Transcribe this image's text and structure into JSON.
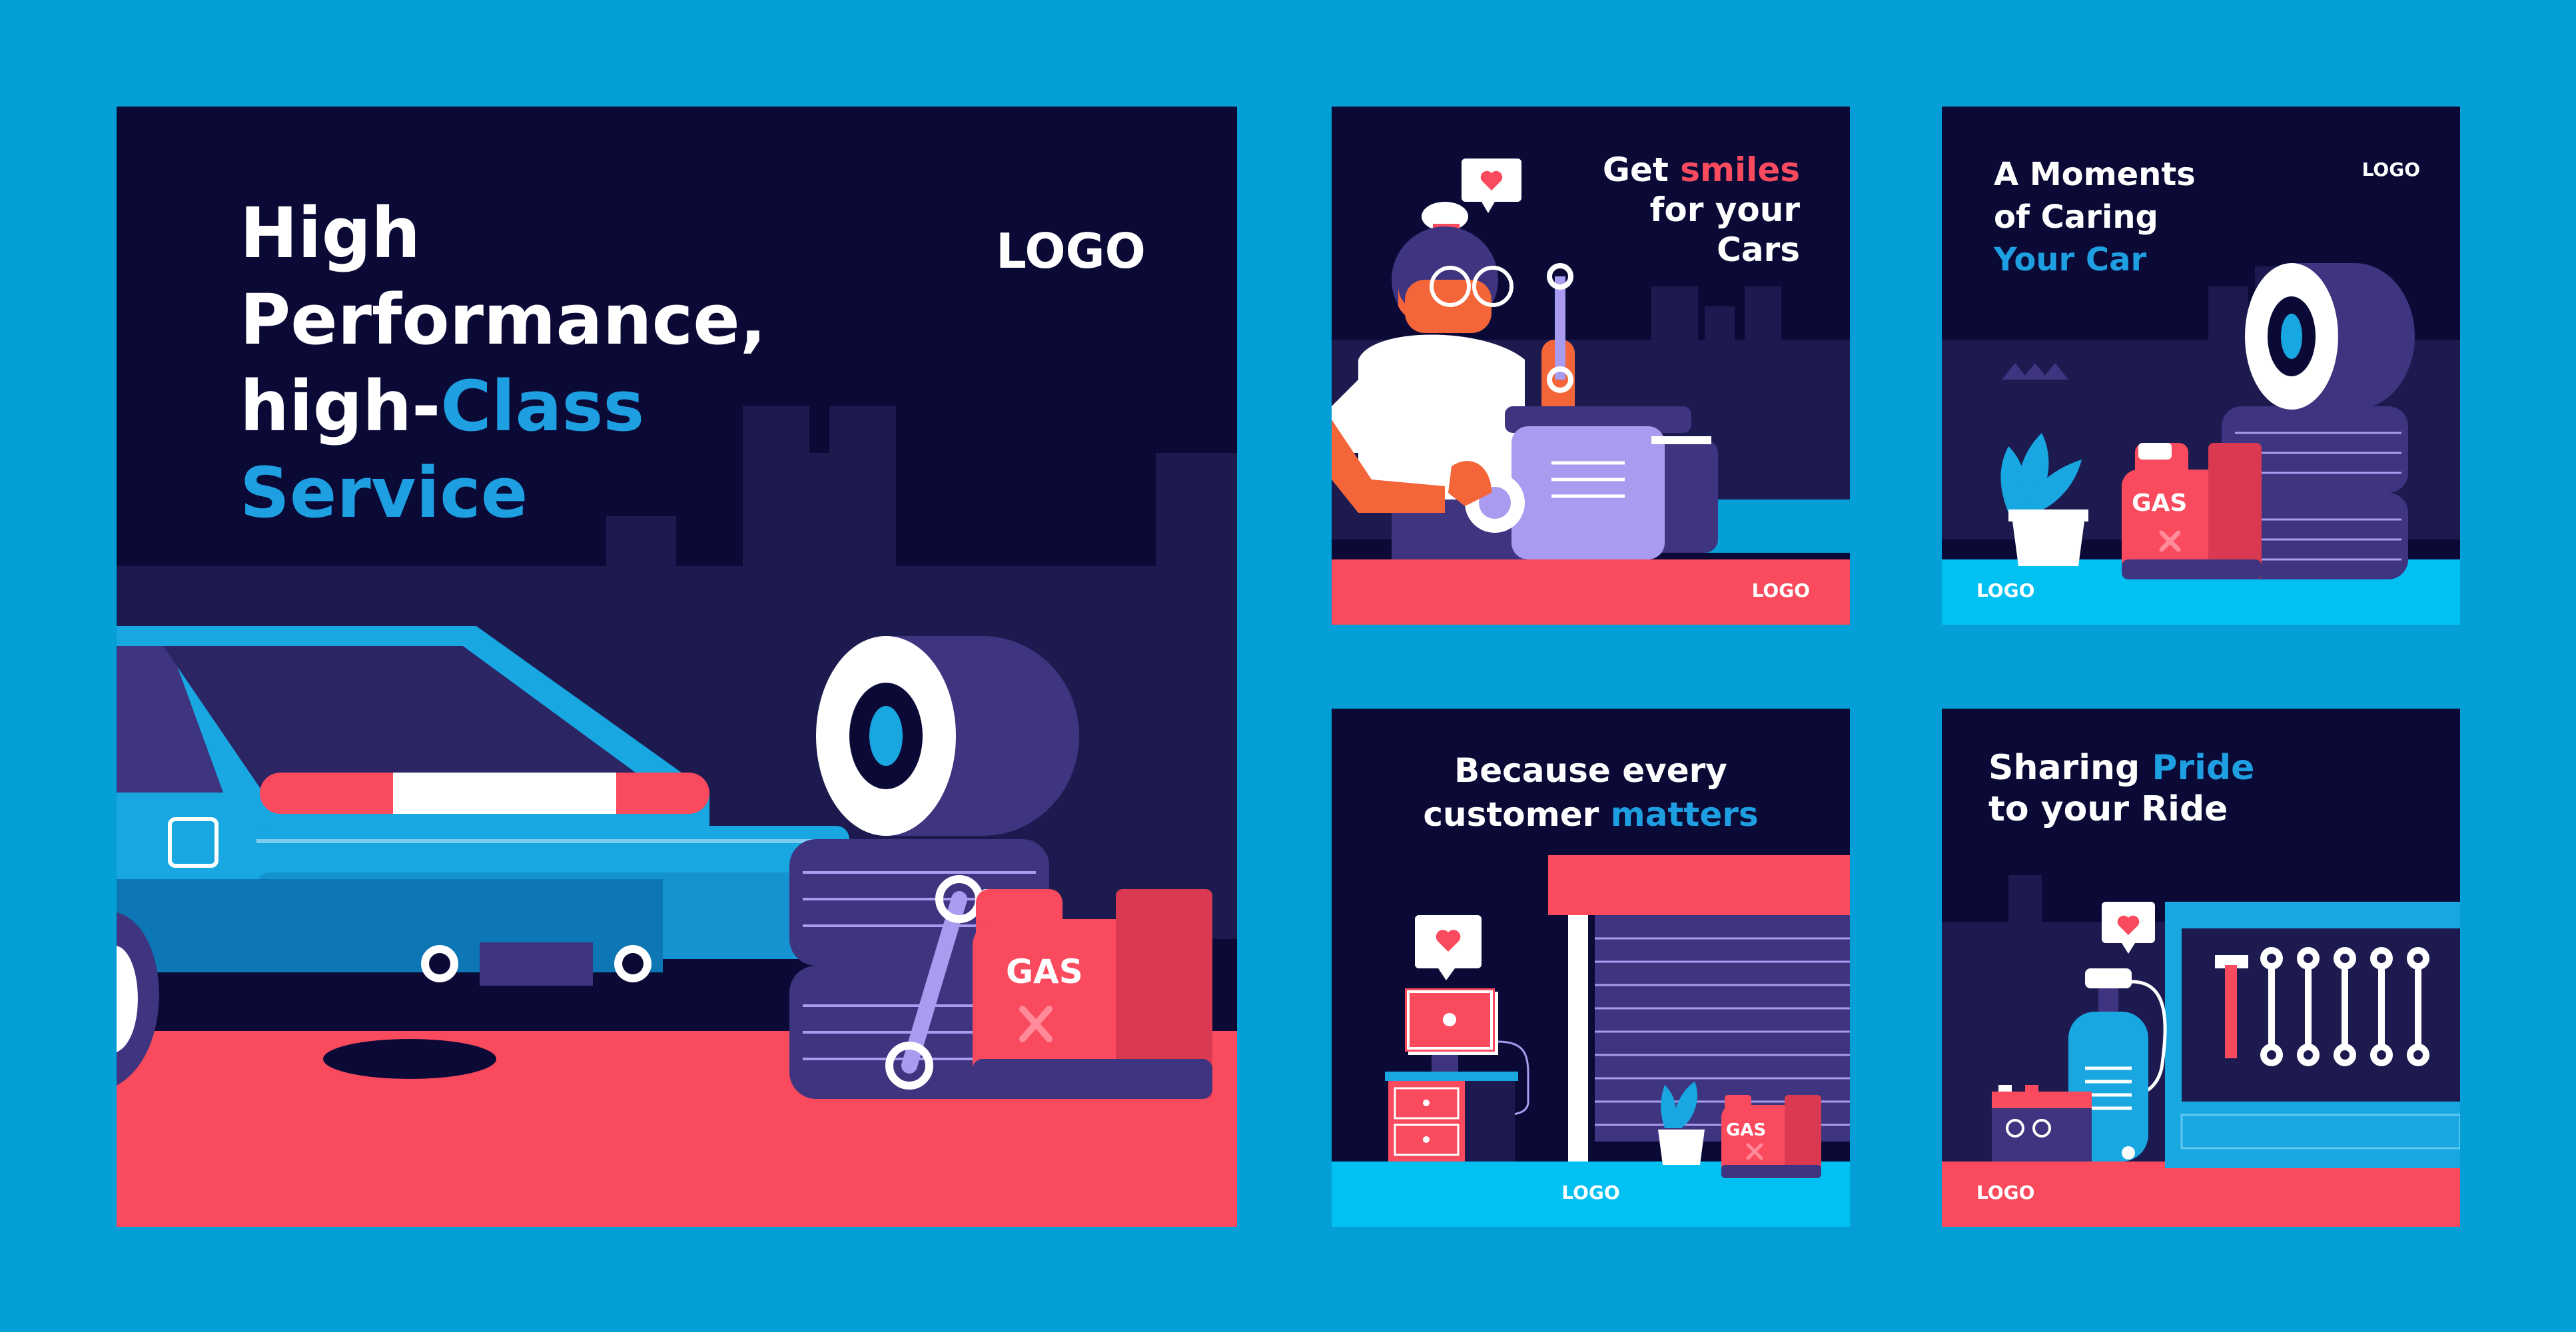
{
  "colors": {
    "background": "#039FD6",
    "navy": "#0B0A36",
    "navy_mid": "#1C1A4E",
    "purple": "#3E3480",
    "lavender": "#A99BEF",
    "blue": "#19A7E2",
    "cyan": "#00C1F2",
    "red": "#F94A5E",
    "highlight_blue": "#1E9FE2",
    "highlight_red": "#F94A5E"
  },
  "cards": {
    "main": {
      "line1": "High",
      "line2": "Performance,",
      "line3_a": "high-",
      "line3_b": "Class",
      "line4": "Service",
      "logo": "LOGO",
      "gas_label": "GAS"
    },
    "smiles": {
      "line1_a": "Get ",
      "line1_b": "smiles",
      "line2": "for your",
      "line3": "Cars",
      "logo": "LOGO"
    },
    "caring": {
      "line1": "A Moments",
      "line2": "of Caring",
      "line3": "Your Car",
      "logo_top": "LOGO",
      "logo_bottom": "LOGO",
      "gas_label": "GAS"
    },
    "customer": {
      "line1": "Because every",
      "line2_a": "customer ",
      "line2_b": "matters",
      "logo": "LOGO",
      "gas_label": "GAS"
    },
    "pride": {
      "line1_a": "Sharing ",
      "line1_b": "Pride",
      "line2": "to your Ride",
      "logo": "LOGO"
    }
  },
  "icons": {
    "heart": "heart-icon",
    "gear": "gear-icon",
    "wrench": "wrench-icon",
    "hammer": "hammer-icon"
  }
}
